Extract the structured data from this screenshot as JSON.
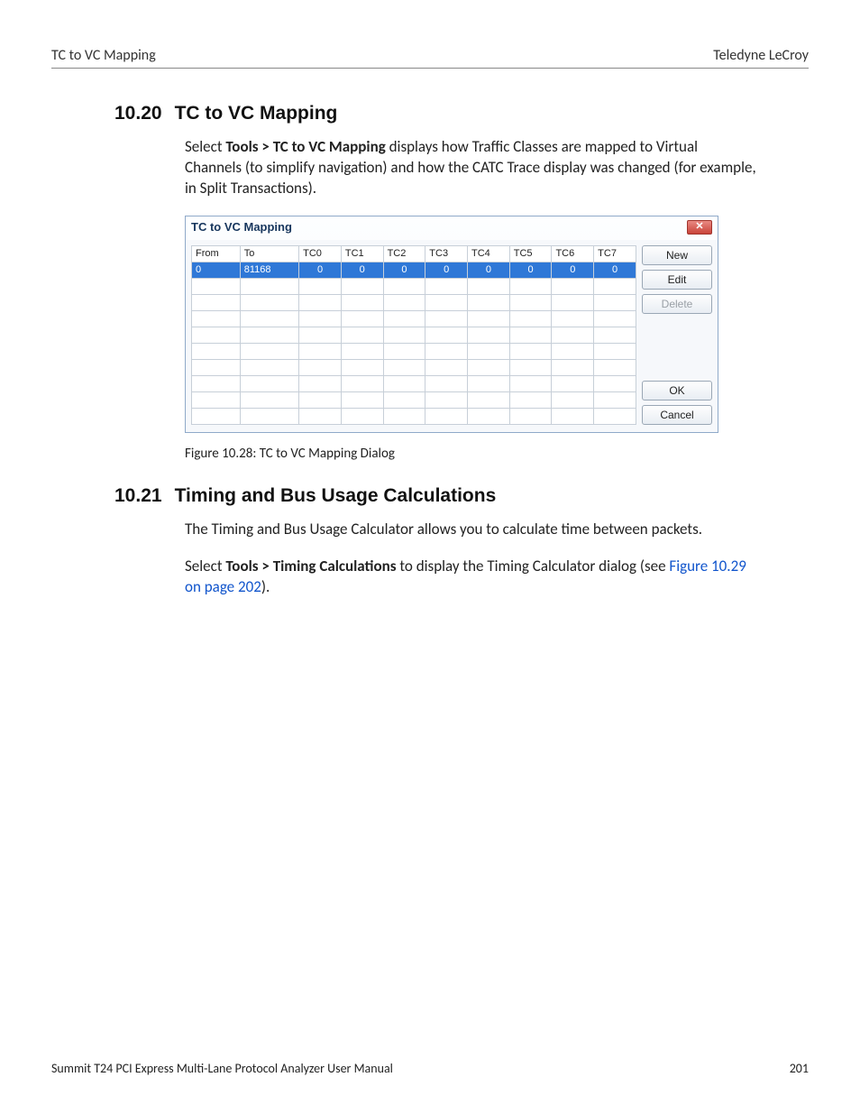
{
  "header": {
    "left": "TC to VC Mapping",
    "right": "Teledyne LeCroy"
  },
  "section1": {
    "num": "10.20",
    "title": "TC to VC Mapping",
    "para_pre": "Select ",
    "para_bold": "Tools > TC to VC Mapping",
    "para_post": " displays how Traffic Classes are mapped to Virtual Channels (to simplify navigation) and how the CATC Trace display was changed (for example, in Split Transactions)."
  },
  "dialog": {
    "title": "TC to VC Mapping",
    "close_glyph": "✕",
    "headers": [
      "From",
      "To",
      "TC0",
      "TC1",
      "TC2",
      "TC3",
      "TC4",
      "TC5",
      "TC6",
      "TC7"
    ],
    "row": {
      "from": "0",
      "to": "81168",
      "tc": [
        "0",
        "0",
        "0",
        "0",
        "0",
        "0",
        "0",
        "0"
      ]
    },
    "blank_rows": 9,
    "buttons": {
      "new_": "New",
      "edit": "Edit",
      "delete_": "Delete",
      "ok": "OK",
      "cancel": "Cancel"
    }
  },
  "figcaption": "Figure 10.28:  TC to VC Mapping Dialog",
  "section2": {
    "num": "10.21",
    "title": "Timing and Bus Usage Calculations",
    "para1": "The Timing and Bus Usage Calculator allows you to calculate time between packets.",
    "para2_pre": "Select ",
    "para2_bold": "Tools > Timing Calculations",
    "para2_mid": " to display the Timing Calculator dialog (see ",
    "para2_link": "Figure 10.29 on page 202",
    "para2_post": ")."
  },
  "footer": {
    "left": "Summit T24 PCI Express Multi-Lane Protocol Analyzer User Manual",
    "right": "201"
  }
}
